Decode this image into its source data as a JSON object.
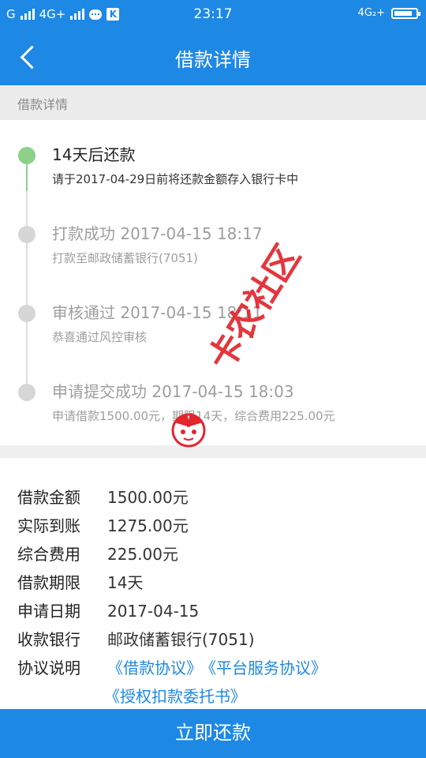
{
  "status_bar": {
    "left_text_1": "G",
    "left_text_2": "4G+",
    "time": "23:17",
    "right_text": "4G₂+"
  },
  "nav": {
    "title": "借款详情"
  },
  "section": {
    "title": "借款详情"
  },
  "timeline": [
    {
      "title": "14天后还款",
      "subtitle": "请于2017-04-29日前将还款金额存入银行卡中",
      "active": true
    },
    {
      "title": "打款成功 2017-04-15 18:17",
      "subtitle": "打款至邮政储蓄银行(7051)",
      "active": false
    },
    {
      "title": "审核通过 2017-04-15 18:11",
      "subtitle": "恭喜通过风控审核",
      "active": false
    },
    {
      "title": "申请提交成功 2017-04-15 18:03",
      "subtitle": "申请借款1500.00元，期限14天，综合费用225.00元",
      "active": false
    }
  ],
  "details": {
    "amount_label": "借款金额",
    "amount": "1500.00元",
    "received_label": "实际到账",
    "received": "1275.00元",
    "fee_label": "综合费用",
    "fee": "225.00元",
    "term_label": "借款期限",
    "term": "14天",
    "date_label": "申请日期",
    "date": "2017-04-15",
    "bank_label": "收款银行",
    "bank": "邮政储蓄银行(7051)",
    "agreement_label": "协议说明",
    "link_loan": "《借款协议》",
    "link_platform": "《平台服务协议》",
    "link_auth": "《授权扣款委托书》"
  },
  "watermark": {
    "text": "卡农社区"
  },
  "footer": {
    "repay_button": "立即还款"
  },
  "colors": {
    "primary": "#1e88e5",
    "active_dot": "#8ed08a",
    "inactive_dot": "#d6d6d6",
    "watermark": "#e2262e"
  }
}
